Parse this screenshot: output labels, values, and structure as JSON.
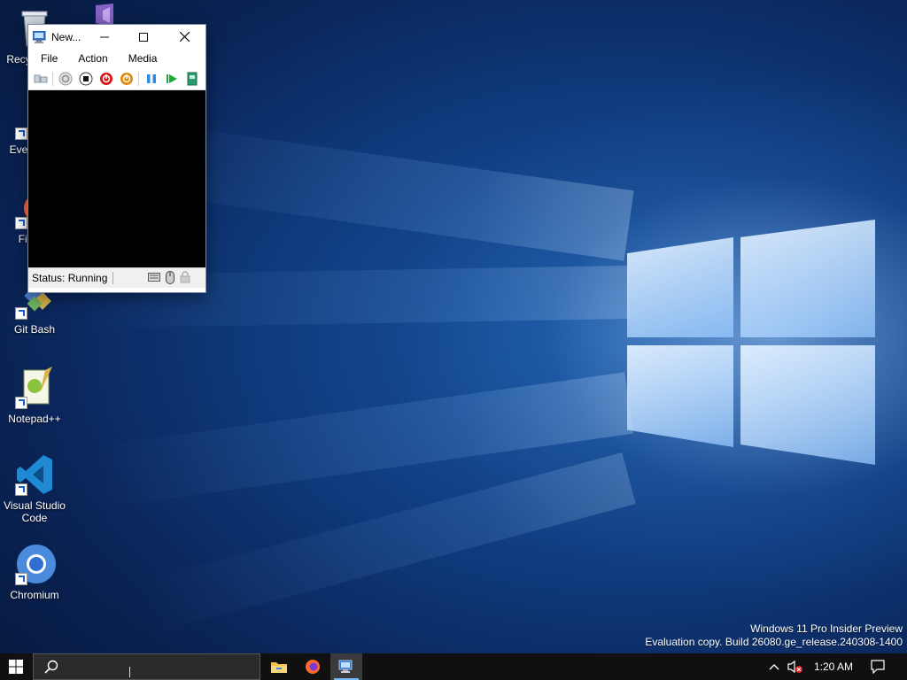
{
  "desktop": {
    "icons": [
      {
        "label": "Recycle Bin"
      },
      {
        "label": "Everything"
      },
      {
        "label": "Firefox"
      },
      {
        "label": "Git Bash"
      },
      {
        "label": "Notepad++"
      },
      {
        "label": "Visual Studio Code"
      },
      {
        "label": "Chromium"
      }
    ],
    "watermark": {
      "line1": "Windows 11 Pro Insider Preview",
      "line2": "Evaluation copy. Build 26080.ge_release.240308-1400"
    }
  },
  "vm_window": {
    "title": "New...",
    "menu": [
      "File",
      "Action",
      "Media"
    ],
    "toolbar_icons": [
      "ctrl-alt-del-icon",
      "start-icon",
      "turn-off-icon",
      "shut-down-icon",
      "save-icon",
      "pause-icon",
      "reset-icon",
      "checkpoint-icon"
    ],
    "status": "Status: Running"
  },
  "taskbar": {
    "clock": "1:20 AM",
    "search_value": ""
  },
  "colors": {
    "taskbar": "#101010",
    "accent": "#79b8ff",
    "desktop_blue": "#0f3a7c"
  }
}
